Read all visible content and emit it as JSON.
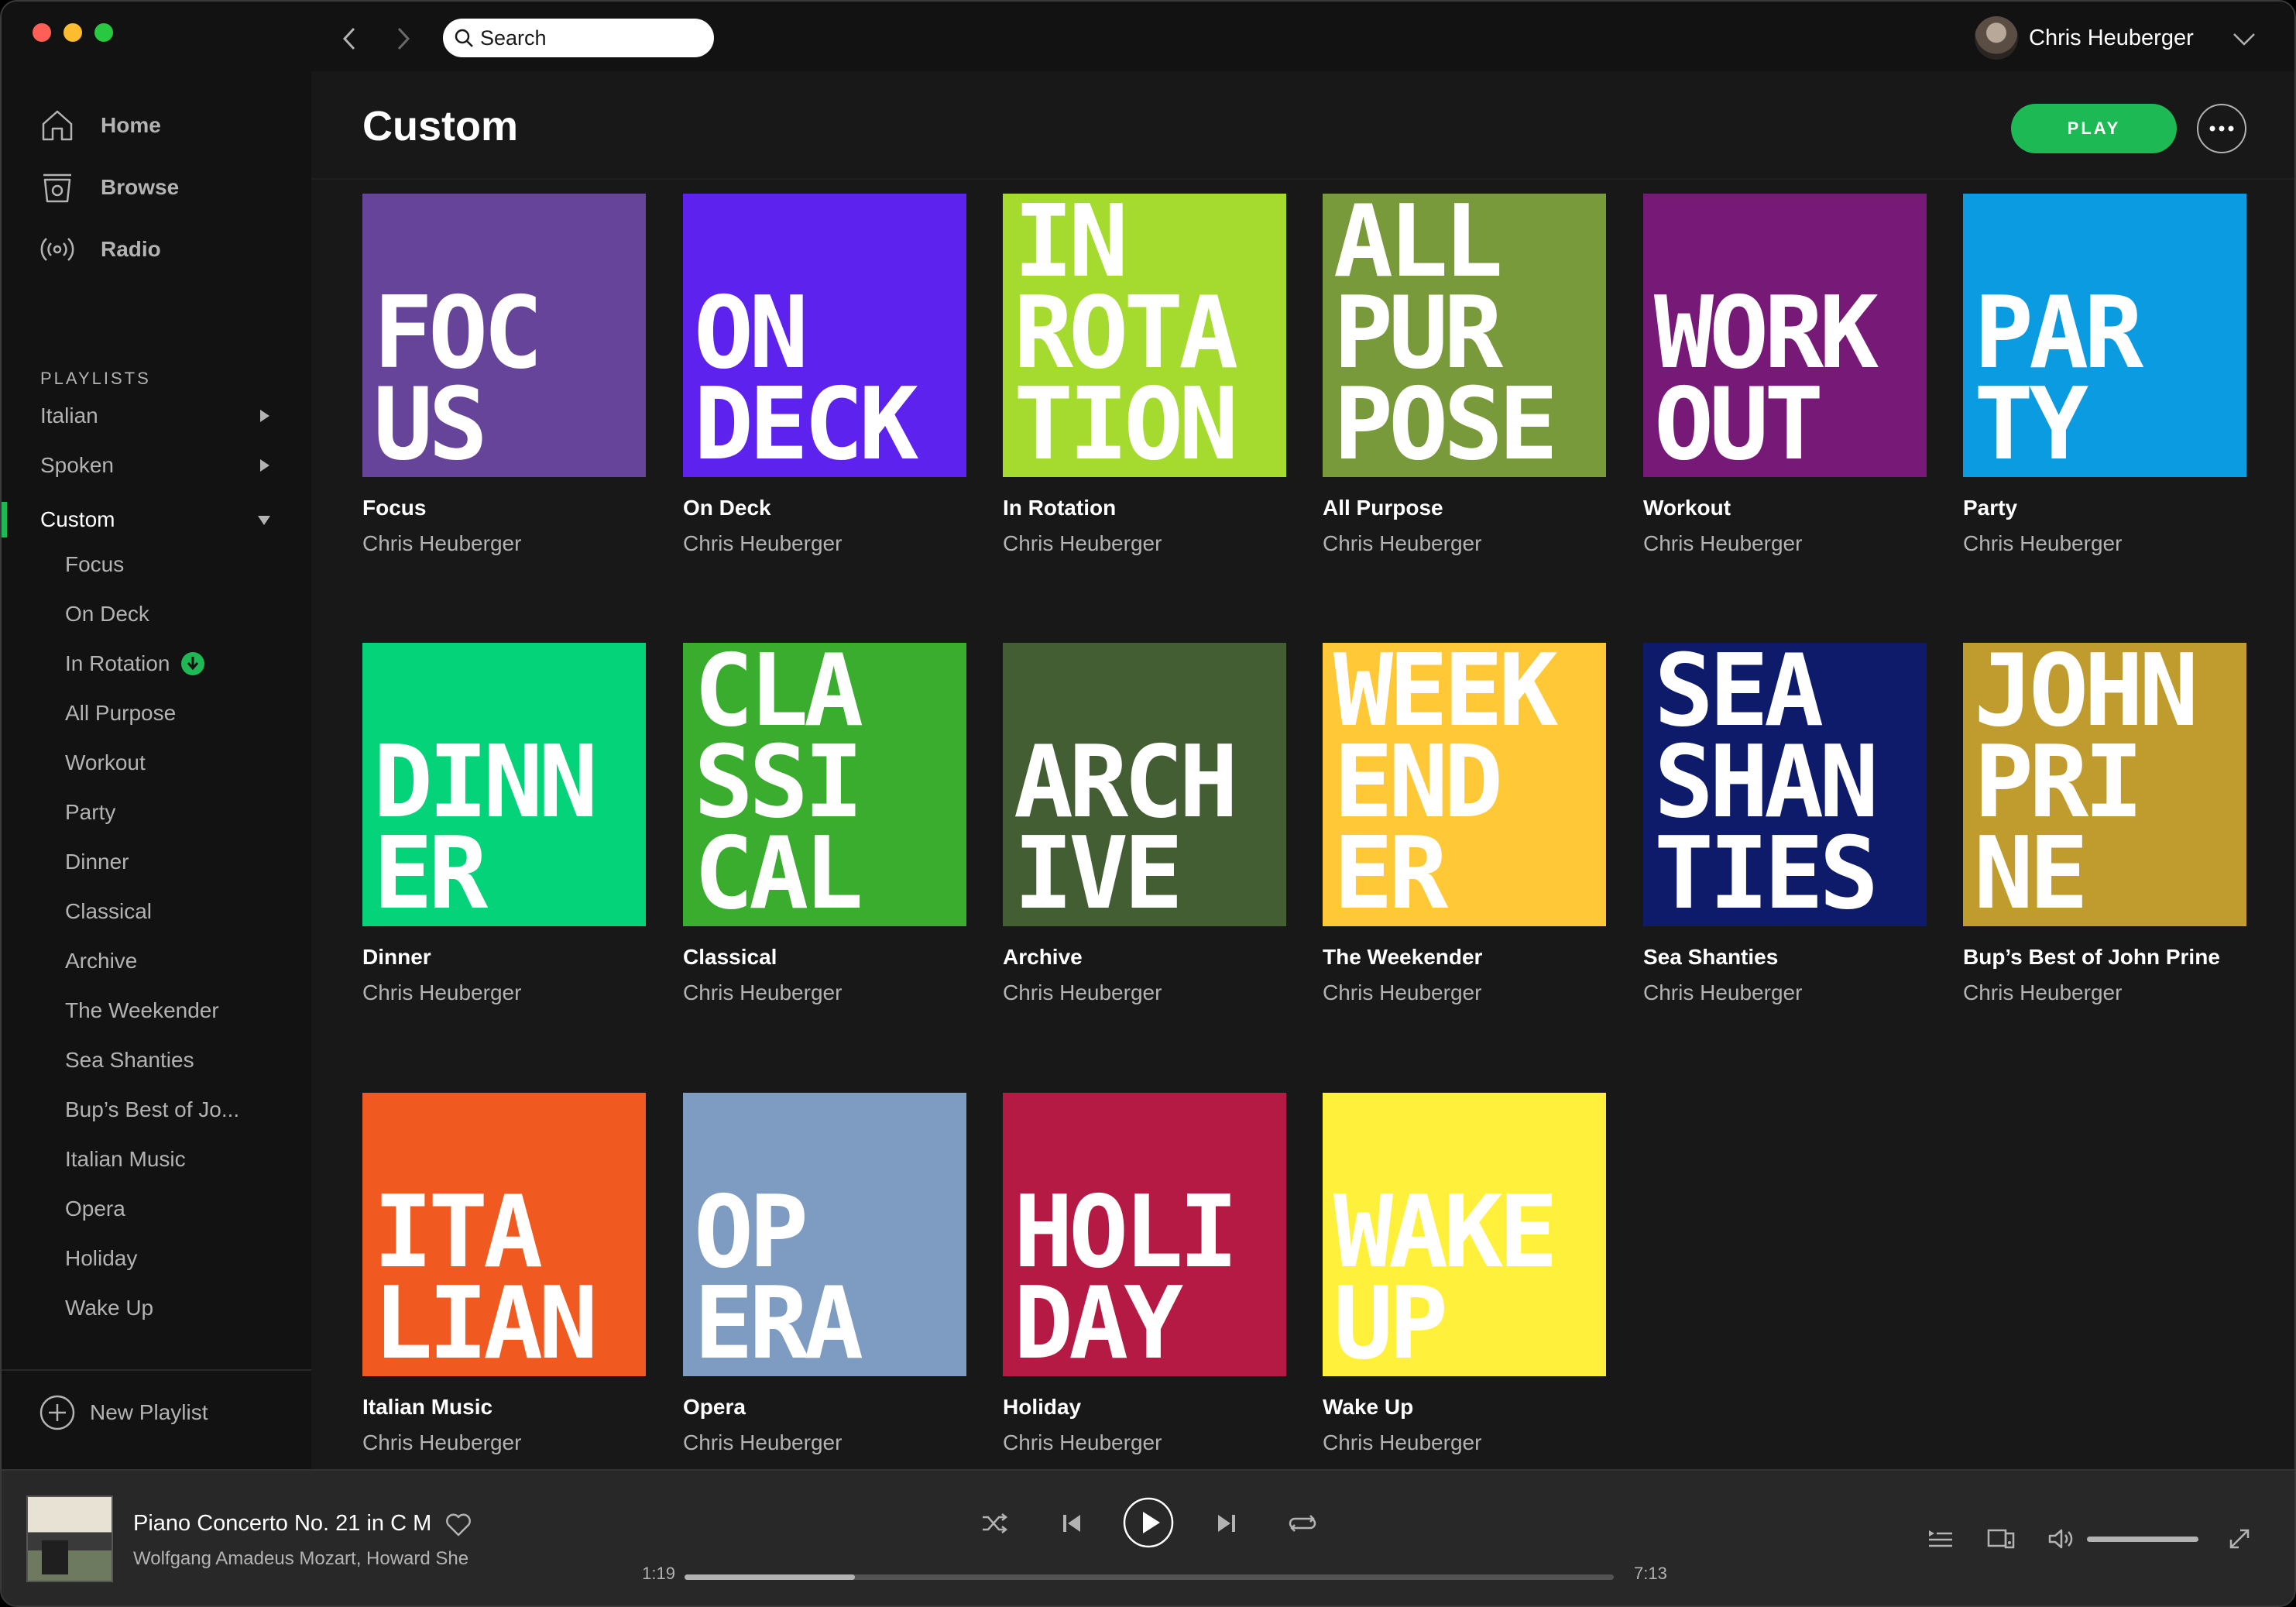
{
  "search": {
    "placeholder": "Search"
  },
  "user": {
    "name": "Chris Heuberger"
  },
  "nav": [
    {
      "label": "Home",
      "icon": "home-icon"
    },
    {
      "label": "Browse",
      "icon": "browse-icon"
    },
    {
      "label": "Radio",
      "icon": "radio-icon"
    }
  ],
  "sidebar": {
    "playlists_heading": "PLAYLISTS",
    "folders": [
      {
        "label": "Italian",
        "expanded": false
      },
      {
        "label": "Spoken",
        "expanded": false
      },
      {
        "label": "Custom",
        "expanded": true
      }
    ],
    "custom_items": [
      {
        "label": "Focus"
      },
      {
        "label": "On Deck"
      },
      {
        "label": "In Rotation",
        "downloaded": true
      },
      {
        "label": "All Purpose"
      },
      {
        "label": "Workout"
      },
      {
        "label": "Party"
      },
      {
        "label": "Dinner"
      },
      {
        "label": "Classical"
      },
      {
        "label": "Archive"
      },
      {
        "label": "The Weekender"
      },
      {
        "label": "Sea Shanties"
      },
      {
        "label": "Bup’s Best of Jo..."
      },
      {
        "label": "Italian Music"
      },
      {
        "label": "Opera"
      },
      {
        "label": "Holiday"
      },
      {
        "label": "Wake Up"
      }
    ],
    "new_playlist": "New Playlist"
  },
  "main": {
    "title": "Custom",
    "play_label": "PLAY",
    "cards": [
      {
        "cover_text": "FOC\nUS",
        "cover_color": "#66449a",
        "title": "Focus",
        "owner": "Chris Heuberger"
      },
      {
        "cover_text": "ON\nDECK",
        "cover_color": "#5e22ee",
        "title": "On Deck",
        "owner": "Chris Heuberger"
      },
      {
        "cover_text": "IN\nROTA\nTION",
        "cover_color": "#a5da2f",
        "title": "In Rotation",
        "owner": "Chris Heuberger"
      },
      {
        "cover_text": "ALL\nPUR\nPOSE",
        "cover_color": "#789a3a",
        "title": "All Purpose",
        "owner": "Chris Heuberger"
      },
      {
        "cover_text": "WORK\nOUT",
        "cover_color": "#771a77",
        "title": "Workout",
        "owner": "Chris Heuberger"
      },
      {
        "cover_text": "PAR\nTY",
        "cover_color": "#0b9be0",
        "title": "Party",
        "owner": "Chris Heuberger"
      },
      {
        "cover_text": "DINN\nER",
        "cover_color": "#05d37a",
        "title": "Dinner",
        "owner": "Chris Heuberger"
      },
      {
        "cover_text": "CLA\nSSI\nCAL",
        "cover_color": "#3aad2e",
        "title": "Classical",
        "owner": "Chris Heuberger"
      },
      {
        "cover_text": "ARCH\nIVE",
        "cover_color": "#435e33",
        "title": "Archive",
        "owner": "Chris Heuberger"
      },
      {
        "cover_text": "WEEK\nEND\nER",
        "cover_color": "#fec837",
        "title": "The Weekender",
        "owner": "Chris Heuberger"
      },
      {
        "cover_text": "SEA\nSHAN\nTIES",
        "cover_color": "#0e1b6b",
        "title": "Sea Shanties",
        "owner": "Chris Heuberger"
      },
      {
        "cover_text": "JOHN\nPRI\nNE",
        "cover_color": "#c09c2e",
        "title": "Bup’s Best of John Prine",
        "owner": "Chris Heuberger"
      },
      {
        "cover_text": "ITA\nLIAN",
        "cover_color": "#f05a21",
        "title": "Italian Music",
        "owner": "Chris Heuberger"
      },
      {
        "cover_text": "OP\nERA",
        "cover_color": "#7e9bc1",
        "title": "Opera",
        "owner": "Chris Heuberger"
      },
      {
        "cover_text": "HOLI\nDAY",
        "cover_color": "#b51a44",
        "title": "Holiday",
        "owner": "Chris Heuberger"
      },
      {
        "cover_text": "WAKE\nUP",
        "cover_color": "#fff03b",
        "title": "Wake Up",
        "owner": "Chris Heuberger"
      }
    ]
  },
  "player": {
    "track_title": "Piano Concerto No. 21 in C M",
    "track_artist": "Wolfgang Amadeus Mozart, Howard She",
    "elapsed": "1:19",
    "total": "7:13",
    "progress": 0.183,
    "volume": 1.0,
    "accent": "#1db954"
  }
}
